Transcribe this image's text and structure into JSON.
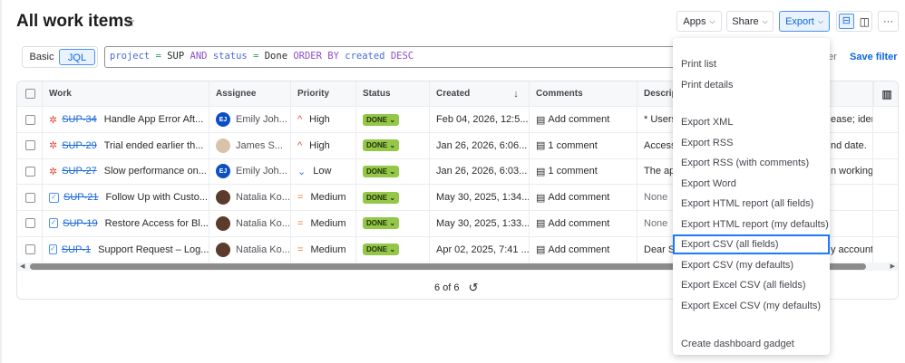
{
  "header": {
    "title": "All work items",
    "apps": "Apps",
    "share": "Share",
    "export": "Export",
    "more": "···"
  },
  "search": {
    "basic": "Basic",
    "jql": "JQL",
    "query": [
      [
        "project",
        "k1"
      ],
      [
        " = ",
        "k2"
      ],
      [
        "SUP ",
        "k0"
      ],
      [
        "AND ",
        "k3"
      ],
      [
        "status",
        "k1"
      ],
      [
        " = ",
        "k2"
      ],
      [
        "Done ",
        "k0"
      ],
      [
        "ORDER BY ",
        "k3"
      ],
      [
        "created ",
        "k1"
      ],
      [
        "DESC",
        "k3"
      ]
    ],
    "hidden_fragment": "er",
    "save_filter": "Save filter"
  },
  "table": {
    "columns": [
      "Work",
      "Assignee",
      "Priority",
      "Status",
      "Created",
      "Comments",
      "Descript"
    ],
    "rows": [
      {
        "type": "bug",
        "key": "SUP-34",
        "summary": "Handle App Error Aft...",
        "avatar": "EJ",
        "av": "ej",
        "assignee": "Emily Joh...",
        "priority_icon": "^",
        "priority_color": "#e2483d",
        "priority": "High",
        "status": "DONE",
        "created": "Feb 04, 2026, 12:5...",
        "comment": "Add comment",
        "desc": "* Users",
        "desc_right": "ease; identi..."
      },
      {
        "type": "bug",
        "key": "SUP-29",
        "summary": "Trial ended earlier th...",
        "avatar": "",
        "av": "js",
        "assignee": "James S...",
        "priority_icon": "^",
        "priority_color": "#e2483d",
        "priority": "High",
        "status": "DONE",
        "created": "Jan 26, 2026, 6:06...",
        "comment": "1 comment",
        "desc": "Access",
        "desc_right": "nd date."
      },
      {
        "type": "bug",
        "key": "SUP-27",
        "summary": "Slow performance on...",
        "avatar": "EJ",
        "av": "ej",
        "assignee": "Emily Joh...",
        "priority_icon": "⌄",
        "priority_color": "#1d7afc",
        "priority": "Low",
        "status": "DONE",
        "created": "Jan 26, 2026, 6:03...",
        "comment": "1 comment",
        "desc": "The app",
        "desc_right": "n working w..."
      },
      {
        "type": "task",
        "key": "SUP-21",
        "summary": "Follow Up with Custo...",
        "avatar": "",
        "av": "nk",
        "assignee": "Natalia Ko...",
        "priority_icon": "=",
        "priority_color": "#e57b2e",
        "priority": "Medium",
        "status": "DONE",
        "created": "May 30, 2025, 1:34...",
        "comment": "Add comment",
        "desc": "None",
        "desc_right": ""
      },
      {
        "type": "task",
        "key": "SUP-19",
        "summary": "Restore Access for Bl...",
        "avatar": "",
        "av": "nk",
        "assignee": "Natalia Ko...",
        "priority_icon": "=",
        "priority_color": "#e57b2e",
        "priority": "Medium",
        "status": "DONE",
        "created": "May 30, 2025, 1:33...",
        "comment": "Add comment",
        "desc": "None",
        "desc_right": ""
      },
      {
        "type": "task",
        "key": "SUP-1",
        "summary": "Support Request – Log...",
        "avatar": "",
        "av": "nk",
        "assignee": "Natalia Ko...",
        "priority_icon": "=",
        "priority_color": "#e57b2e",
        "priority": "Medium",
        "status": "DONE",
        "created": "Apr 02, 2025, 7:41 ...",
        "comment": "Add comment",
        "desc": "Dear S",
        "desc_right": "y account o..."
      }
    ],
    "pager": "6 of 6"
  },
  "export_menu": {
    "items": [
      "Print list",
      "Print details",
      "Export XML",
      "Export RSS",
      "Export RSS (with comments)",
      "Export Word",
      "Export HTML report (all fields)",
      "Export HTML report (my defaults)",
      "Export CSV (all fields)",
      "Export CSV (my defaults)",
      "Export Excel CSV (all fields)",
      "Export Excel CSV (my defaults)",
      "Create dashboard gadget"
    ],
    "selected": "Export CSV (all fields)"
  }
}
